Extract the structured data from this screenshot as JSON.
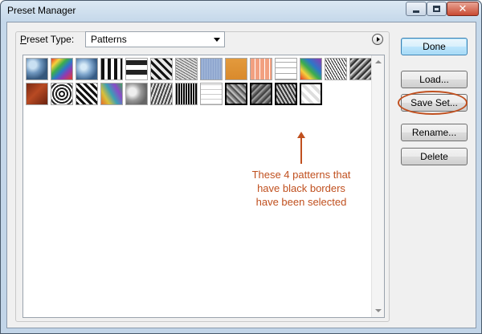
{
  "window": {
    "title": "Preset Manager"
  },
  "controls": {
    "minimize": "minimize-icon",
    "maximize": "maximize-icon",
    "close": "close-icon",
    "close_glyph": "✕"
  },
  "preset_type": {
    "label_prefix": "P",
    "label_rest": "reset Type:",
    "selected": "Patterns"
  },
  "buttons": {
    "done": "Done",
    "load": "Load...",
    "save_set": "Save Set...",
    "rename": "Rename...",
    "delete": "Delete"
  },
  "annotation": {
    "lines": [
      "These 4 patterns that",
      "have black borders",
      "have been selected"
    ],
    "color": "#c0501f"
  },
  "patterns": [
    {
      "name": "bubbles",
      "selected": false
    },
    {
      "name": "tie-dye",
      "selected": false
    },
    {
      "name": "bubbles-2",
      "selected": false
    },
    {
      "name": "black-white-squares",
      "selected": false
    },
    {
      "name": "checkerboard-offset",
      "selected": false
    },
    {
      "name": "zebra-stripes",
      "selected": false
    },
    {
      "name": "noise-gray",
      "selected": false
    },
    {
      "name": "blue-fabric",
      "selected": false
    },
    {
      "name": "orange-paper",
      "selected": false
    },
    {
      "name": "orange-tiles",
      "selected": false
    },
    {
      "name": "grid",
      "selected": false
    },
    {
      "name": "tie-dye-2",
      "selected": false
    },
    {
      "name": "speckle",
      "selected": false
    },
    {
      "name": "gray-stone",
      "selected": false
    },
    {
      "name": "rust",
      "selected": false
    },
    {
      "name": "concentric-squares",
      "selected": false
    },
    {
      "name": "checker-warp",
      "selected": false
    },
    {
      "name": "colorful-blobs",
      "selected": false
    },
    {
      "name": "gray-blobs",
      "selected": false
    },
    {
      "name": "gray-noise-2",
      "selected": false
    },
    {
      "name": "black-white-strip",
      "selected": false
    },
    {
      "name": "white-bricks",
      "selected": false
    },
    {
      "name": "gray-dark-1",
      "selected": true
    },
    {
      "name": "gray-dark-2",
      "selected": true
    },
    {
      "name": "gray-dark-3",
      "selected": true
    },
    {
      "name": "light-checker",
      "selected": true
    }
  ]
}
